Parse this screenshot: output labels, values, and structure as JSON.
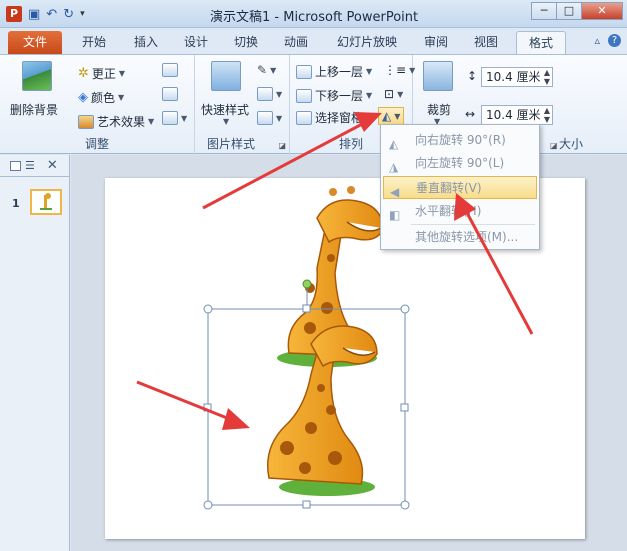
{
  "window": {
    "title": "演示文稿1 - Microsoft PowerPoint",
    "app_icon_letter": "P"
  },
  "tabs": [
    {
      "label": "文件"
    },
    {
      "label": "开始"
    },
    {
      "label": "插入"
    },
    {
      "label": "设计"
    },
    {
      "label": "切换"
    },
    {
      "label": "动画"
    },
    {
      "label": "幻灯片放映"
    },
    {
      "label": "审阅"
    },
    {
      "label": "视图"
    },
    {
      "label": "格式"
    }
  ],
  "ribbon": {
    "adjust": {
      "label": "调整",
      "remove_bg": "删除背景",
      "corrections": "更正",
      "color": "颜色",
      "artistic": "艺术效果"
    },
    "picture_styles": {
      "label": "图片样式",
      "quick_styles": "快速样式"
    },
    "arrange": {
      "label": "排列",
      "bring_forward": "上移一层",
      "send_backward": "下移一层",
      "selection_pane": "选择窗格"
    },
    "size": {
      "label": "大小",
      "crop": "裁剪",
      "height": "10.4 厘米",
      "width": "10.4 厘米"
    }
  },
  "rotate_menu": {
    "items": [
      {
        "label": "向右旋转 90°(R)"
      },
      {
        "label": "向左旋转 90°(L)"
      },
      {
        "label": "垂直翻转(V)"
      },
      {
        "label": "水平翻转(H)"
      },
      {
        "label": "其他旋转选项(M)..."
      }
    ]
  },
  "slides_pane": {
    "slide_number": "1"
  },
  "colors": {
    "accent_file_tab": "#d55a26",
    "highlight": "#f8dd8b",
    "arrow": "#e53a3a"
  }
}
